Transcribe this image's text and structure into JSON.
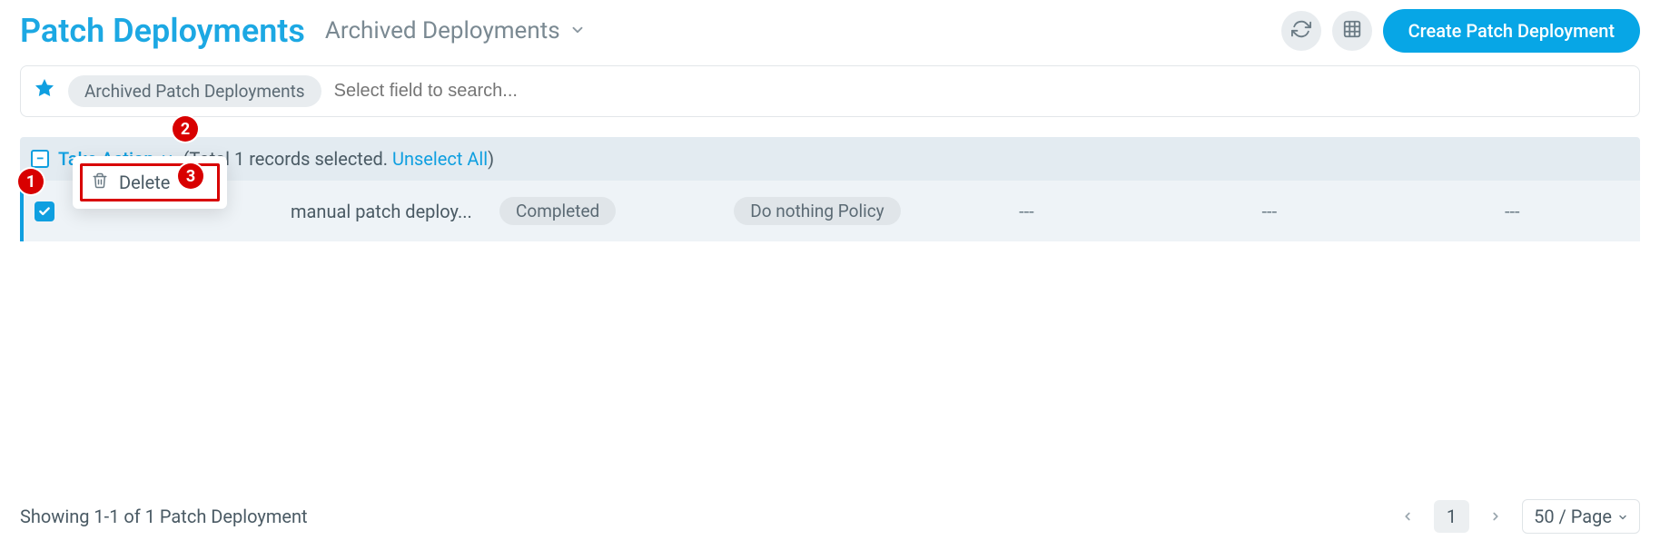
{
  "header": {
    "title": "Patch Deployments",
    "subtitle": "Archived Deployments",
    "create_btn": "Create Patch Deployment"
  },
  "search": {
    "chip": "Archived Patch Deployments",
    "placeholder": "Select field to search..."
  },
  "strip": {
    "take_action": "Take Action",
    "total_prefix": "(Total ",
    "total_count": "1",
    "total_mid": " records selected. ",
    "unselect": "Unselect All",
    "total_suffix": ")"
  },
  "dropdown": {
    "delete": "Delete"
  },
  "row": {
    "name": "manual patch deploy...",
    "status": "Completed",
    "policy": "Do nothing Policy",
    "c1": "---",
    "c2": "---",
    "c3": "---"
  },
  "callouts": {
    "n1": "1",
    "n2": "2",
    "n3": "3"
  },
  "footer": {
    "showing": "Showing 1-1 of 1 Patch Deployment",
    "page": "1",
    "pagesize": "50 / Page"
  }
}
